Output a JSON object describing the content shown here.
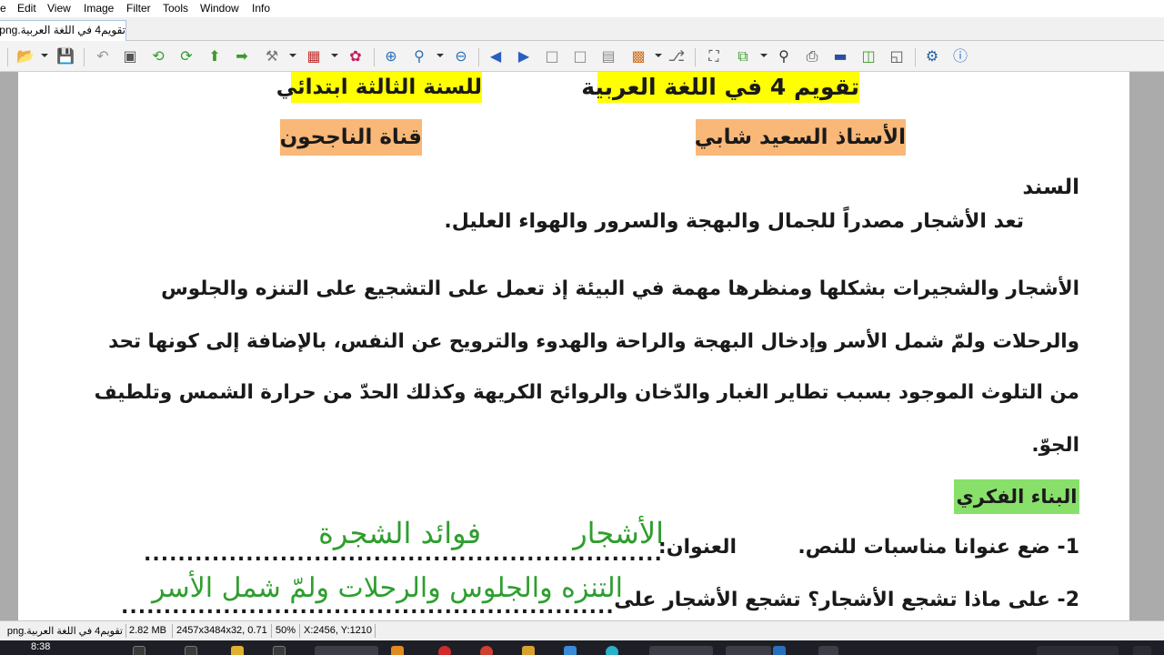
{
  "menu": [
    "e",
    "Edit",
    "View",
    "Image",
    "Filter",
    "Tools",
    "Window",
    "Info"
  ],
  "tab_title": "تقويم4 في اللغة العربية.png",
  "toolbar_icons": [
    "open-folder-icon",
    "save-icon",
    "undo-icon",
    "crop-icon",
    "rotate-left-icon",
    "rotate-right-icon",
    "upload-icon",
    "export-icon",
    "tools-icon",
    "color-icon",
    "effects-icon",
    "zoom-in-icon",
    "zoom-icon",
    "zoom-out-icon",
    "previous-icon",
    "next-icon",
    "first-page-icon",
    "last-page-icon",
    "page-icon",
    "slideshow-icon",
    "lock-icon",
    "fit-window-icon",
    "copy-icon",
    "search-icon",
    "print-icon",
    "scanner-icon",
    "convert-icon",
    "capture-icon",
    "settings-icon",
    "info-icon"
  ],
  "document": {
    "header_left_1": "تقويم 4 في اللغة العربية",
    "header_right_1": "للسنة الثالثة ابتدائي",
    "header_left_2": "الأستاذ السعيد شابي",
    "header_right_2": "قناة الناجحون",
    "section_label": "السند",
    "intro_line": "تعد الأشجار مصدراً للجمال والبهجة والسرور والهواء العليل.",
    "para_line_1": "الأشجار والشجيرات بشكلها ومنظرها مهمة في البيئة إذ تعمل على التشجيع على التنزه والجلوس",
    "para_line_2": "والرحلات ولمّ شمل الأسر وإدخال البهجة والراحة والهدوء والترويح عن النفس، بالإضافة إلى كونها تحد",
    "para_line_3": "من التلوث الموجود بسبب تطاير الغبار والدّخان والروائح الكريهة وكذلك الحدّ من حرارة الشمس وتلطيف",
    "para_line_4": "الجوّ.",
    "build_label": "البناء الفكري",
    "q1": "1- ضع عنوانا مناسبات للنص.",
    "q1_label": "العنوان:",
    "q1_dots": "....................................................................",
    "q1_answer_1": "الأشجار",
    "q1_answer_2": "فوائد الشجرة",
    "q2": "2- على ماذا تشجع الأشجار؟  تشجع الأشجار على",
    "q2_dots": "..................................................................",
    "q2_answer": "التنزه والجلوس والرحلات ولمّ شمل الأسر"
  },
  "status": {
    "filename": "تقويم4 في اللغة العربية.png",
    "filesize": "2.82 MB",
    "dimensions": "2457x3484x32, 0.71",
    "zoom": "50%",
    "coords": "X:2456, Y:1210"
  },
  "taskbar": {
    "clock": "8:38"
  }
}
